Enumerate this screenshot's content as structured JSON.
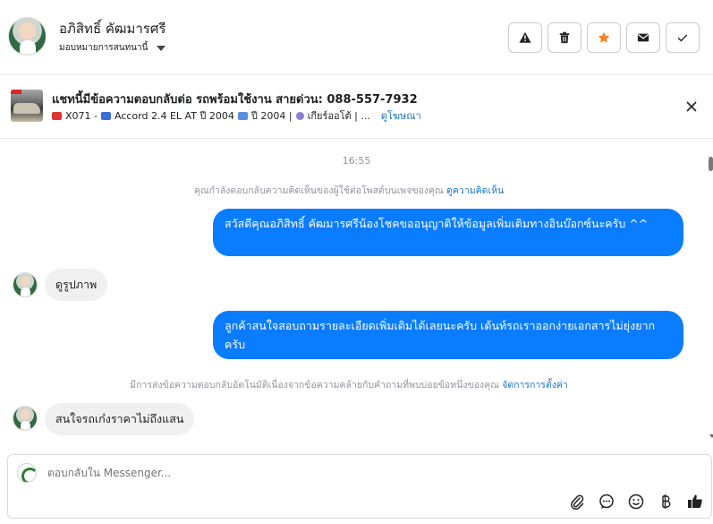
{
  "header": {
    "contact_name": "อภิสิทธิ์ คัฒมารศรี",
    "assign_label": "มอบหมายการสนทนานี้",
    "actions": [
      {
        "name": "report",
        "icon": "warning-icon"
      },
      {
        "name": "delete",
        "icon": "trash-icon"
      },
      {
        "name": "star",
        "icon": "star-icon"
      },
      {
        "name": "mark-unread",
        "icon": "envelope-icon"
      },
      {
        "name": "done",
        "icon": "check-icon"
      }
    ]
  },
  "listing": {
    "title": "แชทนี้มีข้อความตอบกลับต่อ รถพร้อมใช้งาน สายด่วน: 088-557-7932",
    "code": "X071 -",
    "model": "Accord 2.4 EL AT ปี 2004",
    "year": "ปี 2004 |",
    "gear": "เกียร์ออโต้ | ...",
    "view_ad": "ดูโฆษณา"
  },
  "chat": {
    "timestamp": "16:55",
    "reply_note": "คุณกำลังตอบกลับความคิดเห็นของผู้ใช้ต่อโพสต์บนเพจของคุณ",
    "reply_note_link": "ดูความคิดเห็น",
    "messages": [
      {
        "from": "page",
        "text": "สวัสดีคุณอภิสิทธิ์ คัฒมารศรีน้องโชคขออนุญาติให้ข้อมูลเพิ่มเติมทางอินบ๊อกซ์นะครับ ^^"
      },
      {
        "from": "user",
        "text": "ดูรูปภาพ"
      },
      {
        "from": "page",
        "text": "ลูกค้าสนใจสอบถามรายละเอียดเพิ่มเติมได้เลยนะครับ เต้นท์รถเราออกง่ายเอกสารไม่ยุ่งยากครับ"
      },
      {
        "from": "user",
        "text": "สนใจรถเก๋งราคาไม่ถึงแสน"
      }
    ],
    "auto_note": "มีการส่งข้อความตอบกลับอัตโนมัติเนื่องจากข้อความคล้ายกับคำถามที่พบบ่อยข้อหนึ่งของคุณ",
    "auto_note_link": "จัดการการตั้งค่า"
  },
  "composer": {
    "placeholder": "ตอบกลับใน Messenger..."
  },
  "colors": {
    "outgoing_bubble": "#0a7cff",
    "incoming_bubble": "#f0f0f0",
    "link": "#1a73c8",
    "star": "#f5821f"
  }
}
